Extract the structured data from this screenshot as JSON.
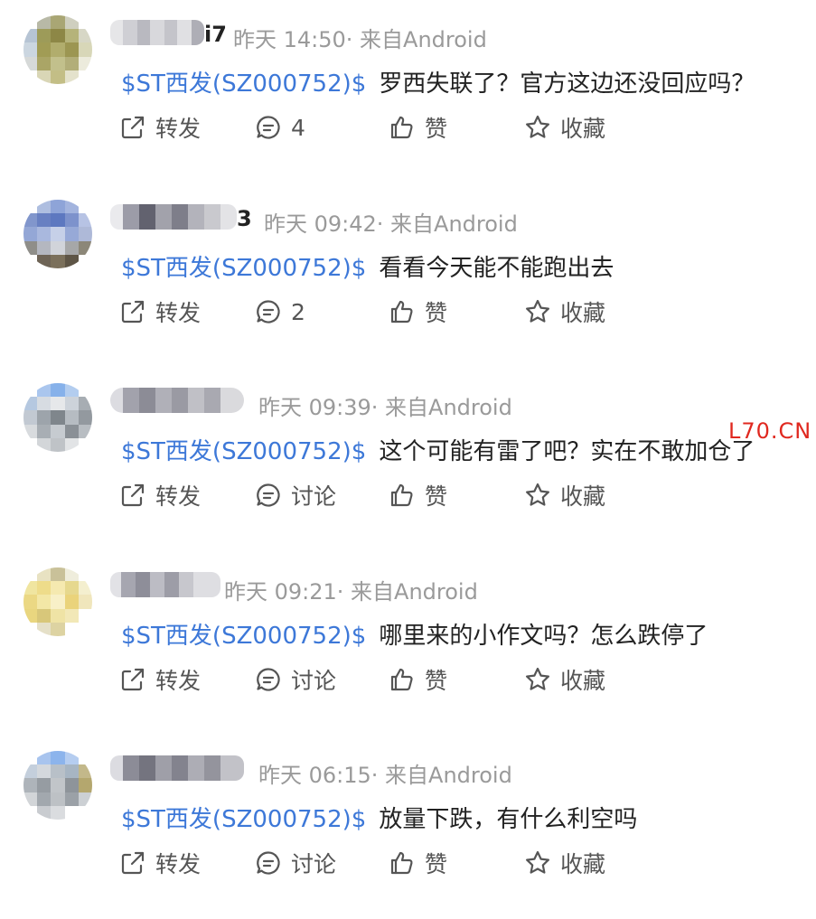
{
  "posts": [
    {
      "name_suffix": "i7",
      "meta": "昨天 14:50· 来自Android",
      "stock_tag": "$ST西发(SZ000752)$",
      "text": "罗西失联了？官方这边还没回应吗？",
      "actions": {
        "repost": "转发",
        "comment": "4",
        "like": "赞",
        "fav": "收藏"
      }
    },
    {
      "name_suffix": "3",
      "meta": "昨天 09:42· 来自Android",
      "stock_tag": "$ST西发(SZ000752)$",
      "text": "看看今天能不能跑出去",
      "actions": {
        "repost": "转发",
        "comment": "2",
        "like": "赞",
        "fav": "收藏"
      }
    },
    {
      "name_suffix": "",
      "meta": "昨天 09:39· 来自Android",
      "stock_tag": "$ST西发(SZ000752)$",
      "text": "这个可能有雷了吧？实在不敢加仓了",
      "actions": {
        "repost": "转发",
        "comment": "讨论",
        "like": "赞",
        "fav": "收藏"
      }
    },
    {
      "name_suffix": "",
      "meta": "昨天 09:21· 来自Android",
      "stock_tag": "$ST西发(SZ000752)$",
      "text": "哪里来的小作文吗？怎么跌停了",
      "actions": {
        "repost": "转发",
        "comment": "讨论",
        "like": "赞",
        "fav": "收藏"
      }
    },
    {
      "name_suffix": "",
      "meta": "昨天 06:15· 来自Android",
      "stock_tag": "$ST西发(SZ000752)$",
      "text": "放量下跌，有什么利空吗",
      "actions": {
        "repost": "转发",
        "comment": "讨论",
        "like": "赞",
        "fav": "收藏"
      }
    }
  ],
  "watermark": "L70.CN",
  "colors": {
    "stock_tag": "#3d78d8",
    "meta": "#9a9a9a",
    "action": "#555555",
    "watermark": "#e0281f"
  },
  "icons": {
    "repost": "share-icon",
    "comment": "comment-icon",
    "like": "thumbs-up-icon",
    "fav": "star-icon"
  }
}
